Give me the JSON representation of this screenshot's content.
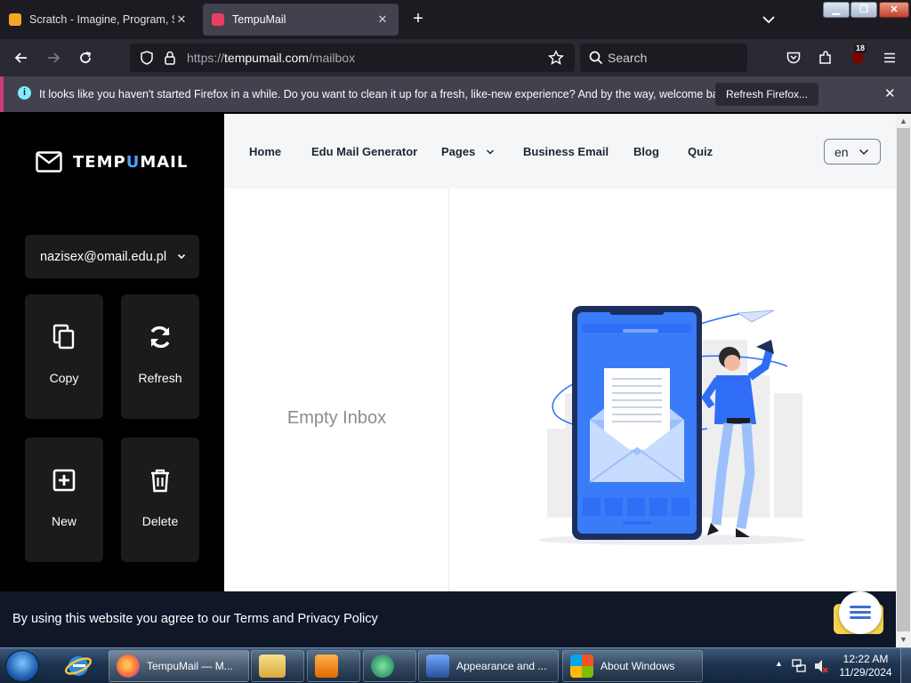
{
  "browser": {
    "tabs": [
      {
        "title": "Scratch - Imagine, Program, Sh",
        "active": false,
        "favicon_color": "#f5a623"
      },
      {
        "title": "TempuMail",
        "active": true,
        "favicon_color": "#e93d62"
      }
    ],
    "url_prefix": "https://",
    "url_host": "tempumail.com",
    "url_path": "/mailbox",
    "search_placeholder": "Search",
    "extension_badge": "18",
    "notification": {
      "message": "It looks like you haven't started Firefox in a while. Do you want to clean it up for a fresh, like-new experience? And by the way, welcome back!",
      "button": "Refresh Firefox..."
    }
  },
  "site": {
    "logo_left": "TEMP",
    "logo_u": "U",
    "logo_right": "MAIL",
    "email": "nazisex@omail.edu.pl",
    "actions": {
      "copy": "Copy",
      "refresh": "Refresh",
      "new": "New",
      "delete": "Delete"
    },
    "nav": {
      "home": "Home",
      "edu": "Edu Mail Generator",
      "pages": "Pages",
      "business": "Business Email",
      "blog": "Blog",
      "quiz": "Quiz"
    },
    "language": "en",
    "empty_inbox": "Empty Inbox",
    "cookie_text": "By using this website you agree to our Terms and Privacy Policy",
    "accent": "#2f6df6"
  },
  "taskbar": {
    "firefox": "TempuMail — M...",
    "appearance": "Appearance and ...",
    "about": "About Windows",
    "time": "12:22 AM",
    "date": "11/29/2024"
  }
}
